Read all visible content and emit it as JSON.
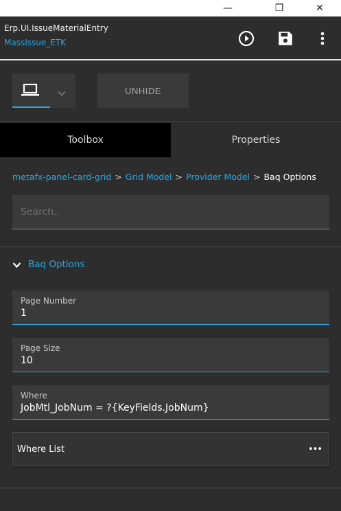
{
  "window": {
    "minimize_glyph": "—",
    "maximize_glyph": "❐",
    "close_glyph": "✕"
  },
  "header": {
    "title": "Erp.UI.IssueMaterialEntry",
    "subtitle": "MassIssue_ETK",
    "icons": [
      "play-circle-icon",
      "save-icon",
      "more-vertical-icon"
    ]
  },
  "toolbar": {
    "device_icon": "laptop-icon",
    "unhide_label": "UNHIDE"
  },
  "tabs": [
    {
      "label": "Toolbox",
      "active": true
    },
    {
      "label": "Properties",
      "active": false
    }
  ],
  "breadcrumb": {
    "items": [
      "metafx-panel-card-grid",
      "Grid Model",
      "Provider Model"
    ],
    "current": "Baq Options",
    "separator": ">"
  },
  "search": {
    "placeholder": "Search..",
    "value": ""
  },
  "section": {
    "title": "Baq Options",
    "expanded": true
  },
  "fields": [
    {
      "label": "Page Number",
      "value": "1"
    },
    {
      "label": "Page Size",
      "value": "10"
    },
    {
      "label": "Where",
      "value": "JobMtl_JobNum = ?{KeyFields.JobNum}"
    }
  ],
  "where_list": {
    "label": "Where List",
    "more": "•••"
  },
  "colors": {
    "accent": "#29a8e0",
    "background": "#2d2d2d",
    "panel": "#3a3a3a",
    "active_tab": "#000000"
  }
}
